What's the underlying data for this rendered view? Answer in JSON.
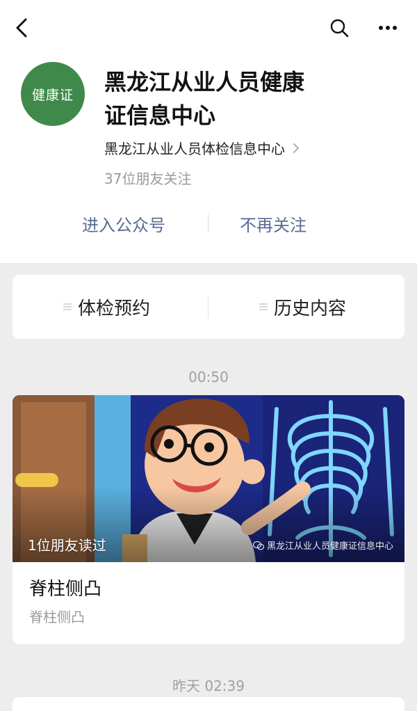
{
  "header": {
    "back_icon": "chevron-left-icon",
    "search_icon": "search-icon",
    "more_icon": "more-horizontal-icon"
  },
  "profile": {
    "avatar_text": "健康证",
    "avatar_color": "#3f8a4a",
    "name_line1": "黑龙江从业人员健康",
    "name_line2": "证信息中心",
    "subject_name": "黑龙江从业人员体检信息中心",
    "followers": "37位朋友关注"
  },
  "actions": {
    "enter_label": "进入公众号",
    "unfollow_label": "不再关注",
    "link_color": "#576b95"
  },
  "menu": {
    "items": [
      {
        "label": "体检预约"
      },
      {
        "label": "历史内容"
      }
    ]
  },
  "feed": {
    "time1": "00:50",
    "article": {
      "read_badge": "1位朋友读过",
      "watermark": "黑龙江从业人员健康证信息中心",
      "title": "脊柱侧凸",
      "digest": "脊柱侧凸"
    },
    "time2": "昨天 02:39"
  }
}
